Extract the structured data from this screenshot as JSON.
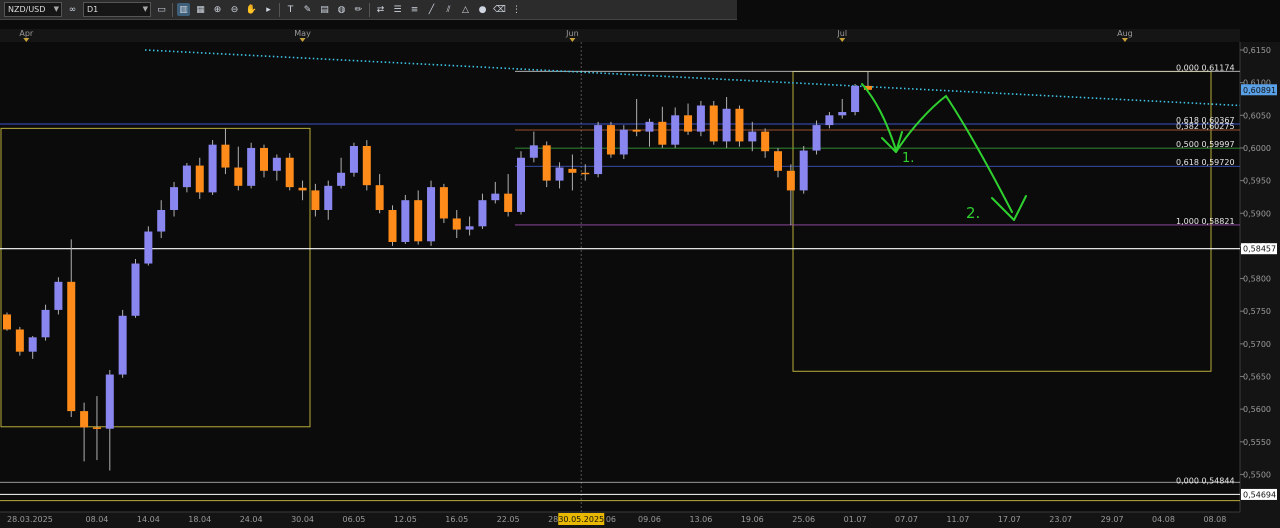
{
  "toolbar": {
    "symbol": "NZD/USD",
    "timeframe": "D1",
    "icons": [
      "chain-icon",
      "chart-type-icon",
      "candles-icon",
      "bars-icon",
      "zoom-in-icon",
      "zoom-out-icon",
      "hand-icon",
      "cursor-icon",
      "text-icon",
      "draw-icon",
      "template-icon",
      "globe-icon",
      "pencil-icon",
      "arrows-icon",
      "object-list-icon",
      "fib-icon",
      "line-tool-icon",
      "channel-icon",
      "shape-icon",
      "circle-icon",
      "eraser-icon",
      "more-icon"
    ]
  },
  "months": [
    {
      "label": "Apr",
      "idx": 1.5
    },
    {
      "label": "May",
      "idx": 23
    },
    {
      "label": "Jun",
      "idx": 44
    },
    {
      "label": "Jul",
      "idx": 65
    },
    {
      "label": "Aug",
      "idx": 87
    }
  ],
  "date_ticks": [
    {
      "label": "28.03.2025",
      "idx": 0
    },
    {
      "label": "08.04",
      "idx": 7
    },
    {
      "label": "14.04",
      "idx": 11
    },
    {
      "label": "18.04",
      "idx": 15
    },
    {
      "label": "24.04",
      "idx": 19
    },
    {
      "label": "30.04",
      "idx": 23
    },
    {
      "label": "06.05",
      "idx": 27
    },
    {
      "label": "12.05",
      "idx": 31
    },
    {
      "label": "16.05",
      "idx": 35
    },
    {
      "label": "22.05",
      "idx": 39
    },
    {
      "label": "28.05",
      "idx": 43
    },
    {
      "label": "06",
      "idx": 47
    },
    {
      "label": "09.06",
      "idx": 50
    },
    {
      "label": "13.06",
      "idx": 54
    },
    {
      "label": "19.06",
      "idx": 58
    },
    {
      "label": "25.06",
      "idx": 62
    },
    {
      "label": "01.07",
      "idx": 66
    },
    {
      "label": "07.07",
      "idx": 70
    },
    {
      "label": "11.07",
      "idx": 74
    },
    {
      "label": "17.07",
      "idx": 78
    },
    {
      "label": "23.07",
      "idx": 82
    },
    {
      "label": "29.07",
      "idx": 86
    },
    {
      "label": "04.08",
      "idx": 90
    },
    {
      "label": "08.08",
      "idx": 94
    }
  ],
  "crosshair_date": "30.05.2025",
  "price_ticks": [
    "0,6150",
    "0,6100",
    "0,6050",
    "0,6000",
    "0,5950",
    "0,5900",
    "0,5850",
    "0,5800",
    "0,5750",
    "0,5700",
    "0,5650",
    "0,5600",
    "0,5550",
    "0,5500"
  ],
  "price_values": [
    0.615,
    0.61,
    0.605,
    0.6,
    0.595,
    0.59,
    0.585,
    0.58,
    0.575,
    0.57,
    0.565,
    0.56,
    0.555,
    0.55
  ],
  "price_boxes": [
    {
      "label": "0,60891",
      "value": 0.60891,
      "color": "#5aa0e6"
    },
    {
      "label": "0,58457",
      "value": 0.58457,
      "color": "#ffffff"
    },
    {
      "label": "0,54694",
      "value": 0.54694,
      "color": "#ffffff"
    }
  ],
  "fib_right": [
    {
      "label": "0,000 0,61174",
      "value": 0.61174,
      "color": "#c8c8c8"
    },
    {
      "label": "0,618 0,60367",
      "value": 0.60367,
      "color": "#3d52c8"
    },
    {
      "label": "0,382 0,60275",
      "value": 0.60275,
      "color": "#d06a3a"
    },
    {
      "label": "0,500 0,59997",
      "value": 0.59997,
      "color": "#3fb13f"
    },
    {
      "label": "0,618 0,59720",
      "value": 0.5972,
      "color": "#4a5fd8"
    },
    {
      "label": "1,000 0,58821",
      "value": 0.58821,
      "color": "#a050b0"
    },
    {
      "label": "0,000 0,54844",
      "value": 0.54844,
      "color": "#c8c8c8"
    }
  ],
  "annotations": {
    "one": "1.",
    "two": "2."
  },
  "colors": {
    "bull": "#8a86f0",
    "bear": "#ff8c1a",
    "wick": "#b0b0b0",
    "trend": "#3fc5e8",
    "box": "#b8ad3a",
    "annotation": "#2fd12f"
  },
  "chart_data": {
    "type": "candlestick",
    "symbol": "NZD/USD",
    "timeframe": "D1",
    "ylim": [
      0.548,
      0.616
    ],
    "candles": [
      {
        "o": 0.5745,
        "h": 0.5748,
        "l": 0.572,
        "c": 0.5722
      },
      {
        "o": 0.5722,
        "h": 0.5726,
        "l": 0.5682,
        "c": 0.5688
      },
      {
        "o": 0.5688,
        "h": 0.5712,
        "l": 0.5677,
        "c": 0.571
      },
      {
        "o": 0.571,
        "h": 0.576,
        "l": 0.5705,
        "c": 0.5752
      },
      {
        "o": 0.5752,
        "h": 0.5802,
        "l": 0.5745,
        "c": 0.5795
      },
      {
        "o": 0.5795,
        "h": 0.586,
        "l": 0.5588,
        "c": 0.5597
      },
      {
        "o": 0.5597,
        "h": 0.561,
        "l": 0.552,
        "c": 0.5572
      },
      {
        "o": 0.5572,
        "h": 0.562,
        "l": 0.5522,
        "c": 0.557
      },
      {
        "o": 0.557,
        "h": 0.566,
        "l": 0.5506,
        "c": 0.5653
      },
      {
        "o": 0.5653,
        "h": 0.5752,
        "l": 0.5648,
        "c": 0.5743
      },
      {
        "o": 0.5743,
        "h": 0.583,
        "l": 0.574,
        "c": 0.5823
      },
      {
        "o": 0.5823,
        "h": 0.588,
        "l": 0.582,
        "c": 0.5872
      },
      {
        "o": 0.5872,
        "h": 0.592,
        "l": 0.5862,
        "c": 0.5905
      },
      {
        "o": 0.5905,
        "h": 0.5948,
        "l": 0.5895,
        "c": 0.594
      },
      {
        "o": 0.594,
        "h": 0.5977,
        "l": 0.5932,
        "c": 0.5973
      },
      {
        "o": 0.5973,
        "h": 0.5985,
        "l": 0.5922,
        "c": 0.5932
      },
      {
        "o": 0.5932,
        "h": 0.6012,
        "l": 0.5928,
        "c": 0.6005
      },
      {
        "o": 0.6005,
        "h": 0.603,
        "l": 0.596,
        "c": 0.597
      },
      {
        "o": 0.597,
        "h": 0.6002,
        "l": 0.5935,
        "c": 0.5942
      },
      {
        "o": 0.5942,
        "h": 0.6008,
        "l": 0.5938,
        "c": 0.6
      },
      {
        "o": 0.6,
        "h": 0.6005,
        "l": 0.5955,
        "c": 0.5965
      },
      {
        "o": 0.5965,
        "h": 0.599,
        "l": 0.595,
        "c": 0.5985
      },
      {
        "o": 0.5985,
        "h": 0.5992,
        "l": 0.5935,
        "c": 0.594
      },
      {
        "o": 0.5939,
        "h": 0.595,
        "l": 0.592,
        "c": 0.5935
      },
      {
        "o": 0.5935,
        "h": 0.5945,
        "l": 0.5895,
        "c": 0.5905
      },
      {
        "o": 0.5905,
        "h": 0.595,
        "l": 0.589,
        "c": 0.5942
      },
      {
        "o": 0.5942,
        "h": 0.5985,
        "l": 0.5938,
        "c": 0.5962
      },
      {
        "o": 0.5962,
        "h": 0.6008,
        "l": 0.5956,
        "c": 0.6003
      },
      {
        "o": 0.6003,
        "h": 0.6012,
        "l": 0.5935,
        "c": 0.5943
      },
      {
        "o": 0.5943,
        "h": 0.596,
        "l": 0.59,
        "c": 0.5905
      },
      {
        "o": 0.5905,
        "h": 0.5912,
        "l": 0.585,
        "c": 0.5856
      },
      {
        "o": 0.5856,
        "h": 0.5928,
        "l": 0.5853,
        "c": 0.592
      },
      {
        "o": 0.592,
        "h": 0.5935,
        "l": 0.5852,
        "c": 0.5857
      },
      {
        "o": 0.5857,
        "h": 0.595,
        "l": 0.585,
        "c": 0.594
      },
      {
        "o": 0.594,
        "h": 0.5945,
        "l": 0.5885,
        "c": 0.5892
      },
      {
        "o": 0.5892,
        "h": 0.5905,
        "l": 0.5862,
        "c": 0.5875
      },
      {
        "o": 0.5875,
        "h": 0.5895,
        "l": 0.5866,
        "c": 0.588
      },
      {
        "o": 0.588,
        "h": 0.593,
        "l": 0.5876,
        "c": 0.592
      },
      {
        "o": 0.592,
        "h": 0.5948,
        "l": 0.5915,
        "c": 0.593
      },
      {
        "o": 0.593,
        "h": 0.596,
        "l": 0.5895,
        "c": 0.5902
      },
      {
        "o": 0.5902,
        "h": 0.5995,
        "l": 0.5898,
        "c": 0.5985
      },
      {
        "o": 0.5985,
        "h": 0.6025,
        "l": 0.5978,
        "c": 0.6004
      },
      {
        "o": 0.6004,
        "h": 0.601,
        "l": 0.594,
        "c": 0.595
      },
      {
        "o": 0.595,
        "h": 0.5978,
        "l": 0.5938,
        "c": 0.597
      },
      {
        "o": 0.5968,
        "h": 0.599,
        "l": 0.5935,
        "c": 0.5962
      },
      {
        "o": 0.5962,
        "h": 0.5975,
        "l": 0.595,
        "c": 0.596
      },
      {
        "o": 0.596,
        "h": 0.604,
        "l": 0.5955,
        "c": 0.6035
      },
      {
        "o": 0.6035,
        "h": 0.604,
        "l": 0.5985,
        "c": 0.599
      },
      {
        "o": 0.599,
        "h": 0.6035,
        "l": 0.5983,
        "c": 0.6028
      },
      {
        "o": 0.6028,
        "h": 0.6075,
        "l": 0.6018,
        "c": 0.6025
      },
      {
        "o": 0.6025,
        "h": 0.6045,
        "l": 0.6002,
        "c": 0.604
      },
      {
        "o": 0.604,
        "h": 0.6063,
        "l": 0.6,
        "c": 0.6005
      },
      {
        "o": 0.6005,
        "h": 0.6062,
        "l": 0.6,
        "c": 0.605
      },
      {
        "o": 0.605,
        "h": 0.6068,
        "l": 0.602,
        "c": 0.6025
      },
      {
        "o": 0.6025,
        "h": 0.6072,
        "l": 0.6018,
        "c": 0.6065
      },
      {
        "o": 0.6065,
        "h": 0.6072,
        "l": 0.6005,
        "c": 0.601
      },
      {
        "o": 0.601,
        "h": 0.6078,
        "l": 0.6,
        "c": 0.606
      },
      {
        "o": 0.606,
        "h": 0.6065,
        "l": 0.6002,
        "c": 0.601
      },
      {
        "o": 0.601,
        "h": 0.604,
        "l": 0.5995,
        "c": 0.6025
      },
      {
        "o": 0.6025,
        "h": 0.603,
        "l": 0.5985,
        "c": 0.5995
      },
      {
        "o": 0.5995,
        "h": 0.6,
        "l": 0.5955,
        "c": 0.5965
      },
      {
        "o": 0.5965,
        "h": 0.5975,
        "l": 0.5882,
        "c": 0.5935
      },
      {
        "o": 0.5935,
        "h": 0.6003,
        "l": 0.593,
        "c": 0.5996
      },
      {
        "o": 0.5996,
        "h": 0.6042,
        "l": 0.599,
        "c": 0.6035
      },
      {
        "o": 0.6035,
        "h": 0.6055,
        "l": 0.603,
        "c": 0.605
      },
      {
        "o": 0.605,
        "h": 0.6075,
        "l": 0.6045,
        "c": 0.6055
      },
      {
        "o": 0.6055,
        "h": 0.6098,
        "l": 0.605,
        "c": 0.6095
      },
      {
        "o": 0.6095,
        "h": 0.6117,
        "l": 0.6085,
        "c": 0.6089
      }
    ]
  }
}
